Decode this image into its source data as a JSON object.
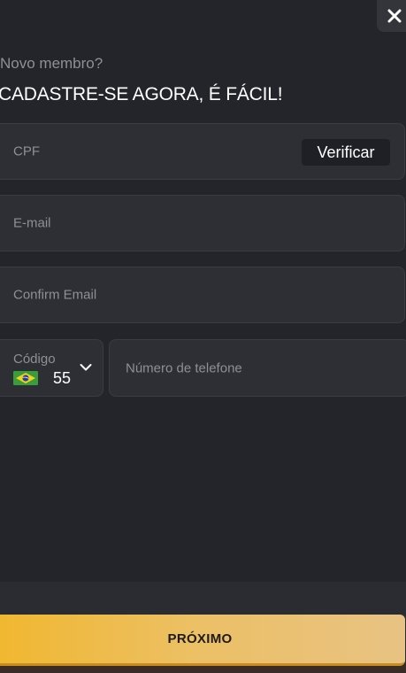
{
  "header": {
    "subtitle": "Novo membro?",
    "title": "CADASTRE-SE AGORA, É FÁCIL!"
  },
  "form": {
    "cpf": {
      "placeholder": "CPF",
      "verify_label": "Verificar"
    },
    "email": {
      "placeholder": "E-mail"
    },
    "confirm_email": {
      "placeholder": "Confirm Email"
    },
    "phone": {
      "code_label": "Código",
      "country_flag": "brazil-flag",
      "code_value": "55",
      "placeholder": "Número de telefone"
    }
  },
  "footer": {
    "next_label": "PRÓXIMO"
  },
  "icons": {
    "close": "close-icon",
    "dropdown": "chevron-down-icon"
  },
  "colors": {
    "background": "#24252a",
    "field": "#2e2f35",
    "button_gradient_start": "#f0b72f",
    "button_gradient_end": "#e8c283"
  }
}
